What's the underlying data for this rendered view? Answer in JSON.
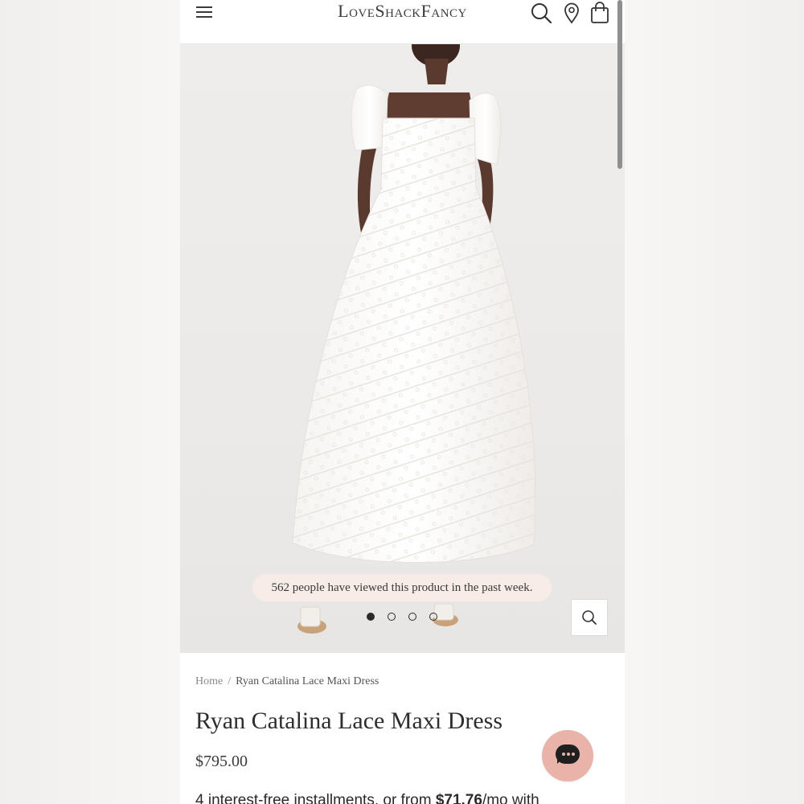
{
  "header": {
    "logo": "LoveShackFancy",
    "icons": [
      "menu-icon",
      "search-icon",
      "location-pin-icon",
      "shopping-bag-icon"
    ]
  },
  "gallery": {
    "viewed_notice": "562 people have viewed this product in the past week.",
    "slide_count": 4,
    "active_slide": 1,
    "zoom_icon": "magnifier-icon"
  },
  "breadcrumb": {
    "home": "Home",
    "separator": "/",
    "current": "Ryan Catalina Lace Maxi Dress"
  },
  "product": {
    "title": "Ryan Catalina Lace Maxi Dress",
    "price": "$795.00",
    "installments_start": "4 interest-free installments, or from ",
    "installments_amount": "$71.76",
    "installments_end": "/mo with"
  },
  "chat": {
    "icon": "chat-icon"
  },
  "colors": {
    "chat_bubble": "#e9b3aa",
    "viewed_pill": "#f8ece8",
    "text_dark": "#2e2e2e"
  }
}
